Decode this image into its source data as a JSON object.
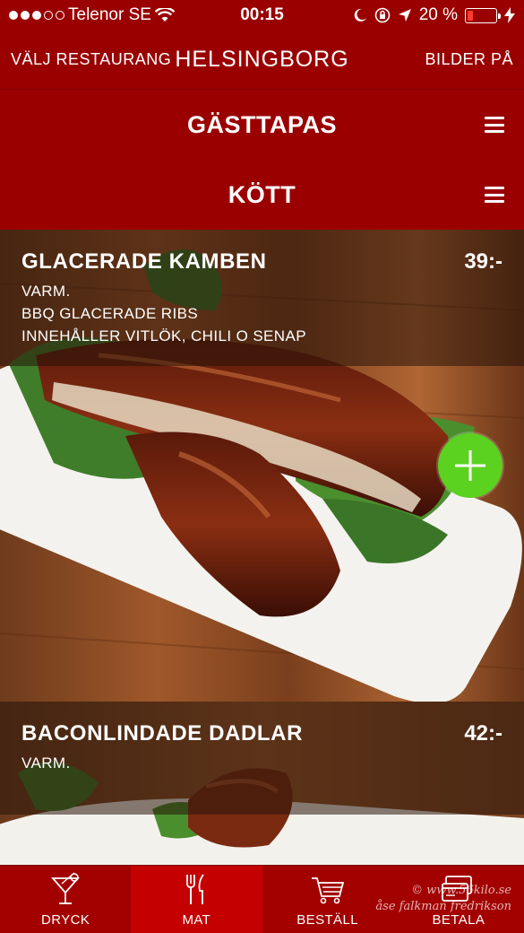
{
  "status_bar": {
    "carrier": "Telenor SE",
    "time": "00:15",
    "battery_percent_label": "20 %",
    "battery_level": 0.2,
    "signal_icon": "signal-dots-icon",
    "wifi_icon": "wifi-icon",
    "icons": [
      "moon-icon",
      "rotation-lock-icon",
      "location-arrow-icon",
      "charging-bolt-icon"
    ]
  },
  "top_nav": {
    "left_label": "VÄLJ RESTAURANG",
    "title": "HELSINGBORG",
    "right_label": "BILDER PÅ"
  },
  "categories": [
    {
      "title": "GÄSTTAPAS",
      "icon": "hamburger-menu-icon"
    },
    {
      "title": "KÖTT",
      "icon": "hamburger-menu-icon"
    }
  ],
  "items": [
    {
      "name": "GLACERADE KAMBEN",
      "price": "39:-",
      "description": [
        "VARM.",
        "BBQ GLACERADE RIBS",
        "INNEHÅLLER VITLÖK, CHILI O SENAP"
      ],
      "add_icon": "plus-icon"
    },
    {
      "name": "BACONLINDADE DADLAR",
      "price": "42:-",
      "description": [
        "VARM."
      ]
    }
  ],
  "tab_bar": {
    "tabs": [
      {
        "label": "DRYCK",
        "icon": "cocktail-glass-icon",
        "active": false
      },
      {
        "label": "MAT",
        "icon": "fork-knife-icon",
        "active": true
      },
      {
        "label": "BESTÄLL",
        "icon": "shopping-cart-icon",
        "active": false
      },
      {
        "label": "BETALA",
        "icon": "credit-card-icon",
        "active": false
      }
    ]
  },
  "watermark": {
    "line1": "© www.56kilo.se",
    "line2": "åse falkman fredrikson"
  },
  "colors": {
    "header_red": "#9a0000",
    "tab_active": "#c40000",
    "add_green": "#5bd21f"
  }
}
